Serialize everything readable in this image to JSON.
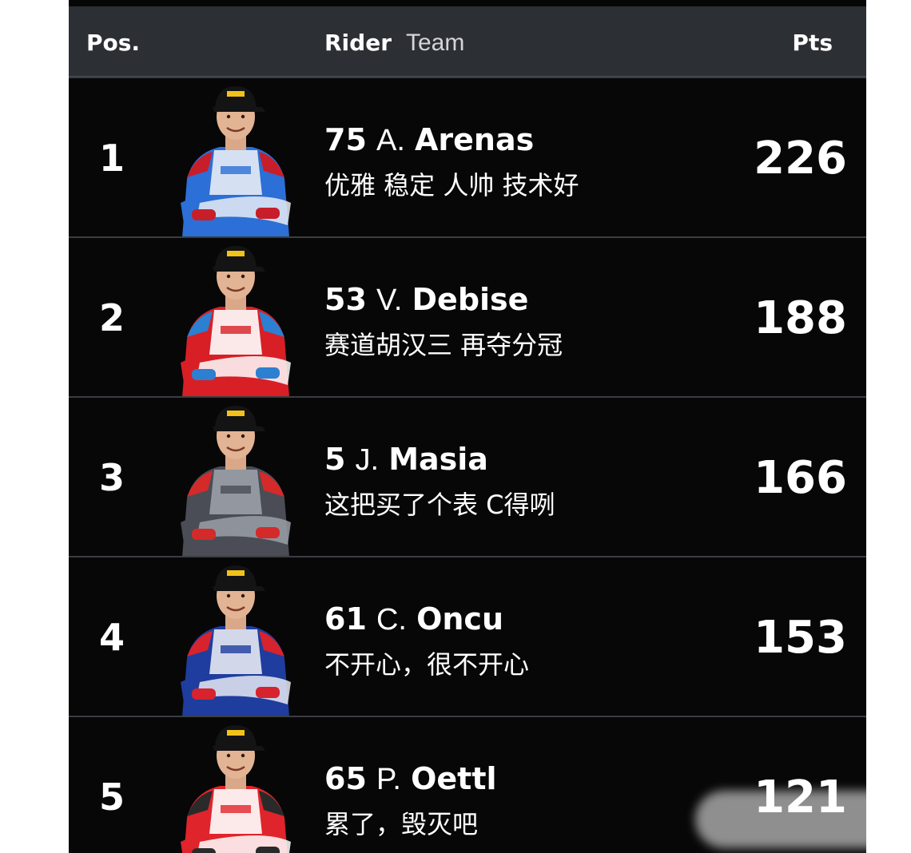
{
  "header": {
    "pos": "Pos.",
    "rider": "Rider",
    "team": "Team",
    "pts": "Pts"
  },
  "rows": [
    {
      "pos": "1",
      "number": "75",
      "initial": "A.",
      "surname": "Arenas",
      "team": "优雅 稳定 人帅 技术好",
      "pts": "226",
      "suit_primary": "#2c6fd6",
      "suit_secondary": "#e8edf5",
      "suit_accent": "#c81e2a"
    },
    {
      "pos": "2",
      "number": "53",
      "initial": "V.",
      "surname": "Debise",
      "team": "赛道胡汉三 再夺分冠",
      "pts": "188",
      "suit_primary": "#d81f26",
      "suit_secondary": "#ffffff",
      "suit_accent": "#2c7fd1"
    },
    {
      "pos": "3",
      "number": "5",
      "initial": "J.",
      "surname": "Masia",
      "team": "这把买了个表 C得咧",
      "pts": "166",
      "suit_primary": "#4a4d55",
      "suit_secondary": "#9aa0a8",
      "suit_accent": "#d42a2a"
    },
    {
      "pos": "4",
      "number": "61",
      "initial": "C.",
      "surname": "Oncu",
      "team": "不开心，很不开心",
      "pts": "153",
      "suit_primary": "#1f3d9e",
      "suit_secondary": "#e6e9f2",
      "suit_accent": "#d6232d"
    },
    {
      "pos": "5",
      "number": "65",
      "initial": "P.",
      "surname": "Oettl",
      "team": "累了，毁灭吧",
      "pts": "121",
      "suit_primary": "#e0242b",
      "suit_secondary": "#ffffff",
      "suit_accent": "#2a2a2a"
    }
  ]
}
